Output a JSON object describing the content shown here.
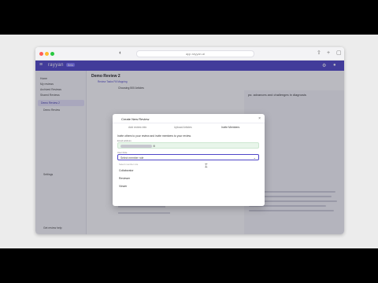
{
  "browser": {
    "url": "app.rayyan.ai"
  },
  "app": {
    "brand": "rayyan",
    "badge": "Beta"
  },
  "sidebar": {
    "items": [
      {
        "label": "Home"
      },
      {
        "label": "My reviews"
      },
      {
        "label": "Archived Reviews"
      },
      {
        "label": "Shared Reviews"
      },
      {
        "label": "Demo Review 2"
      },
      {
        "label": "Demo Review"
      },
      {
        "label": "Settings"
      },
      {
        "label": "Get review help"
      }
    ]
  },
  "main": {
    "title": "Demo Review 2",
    "tags": "Review Tasks   Fill Mapping",
    "breadcrumb": "Choosing 500 Articles",
    "right_heading": "ps: advances and challenges in diagnosis"
  },
  "modal": {
    "title": "Create New Review",
    "steps": [
      "Add review info",
      "Upload Articles",
      "Invite Members"
    ],
    "instructions": "Invite others to your review and invite members to your review.",
    "email_label": "Email address",
    "role_label": "User Role",
    "role_placeholder": "Select member role",
    "dropdown_label": "Select member role",
    "options": [
      "Collaborator",
      "Reviewer",
      "Viewer"
    ]
  }
}
